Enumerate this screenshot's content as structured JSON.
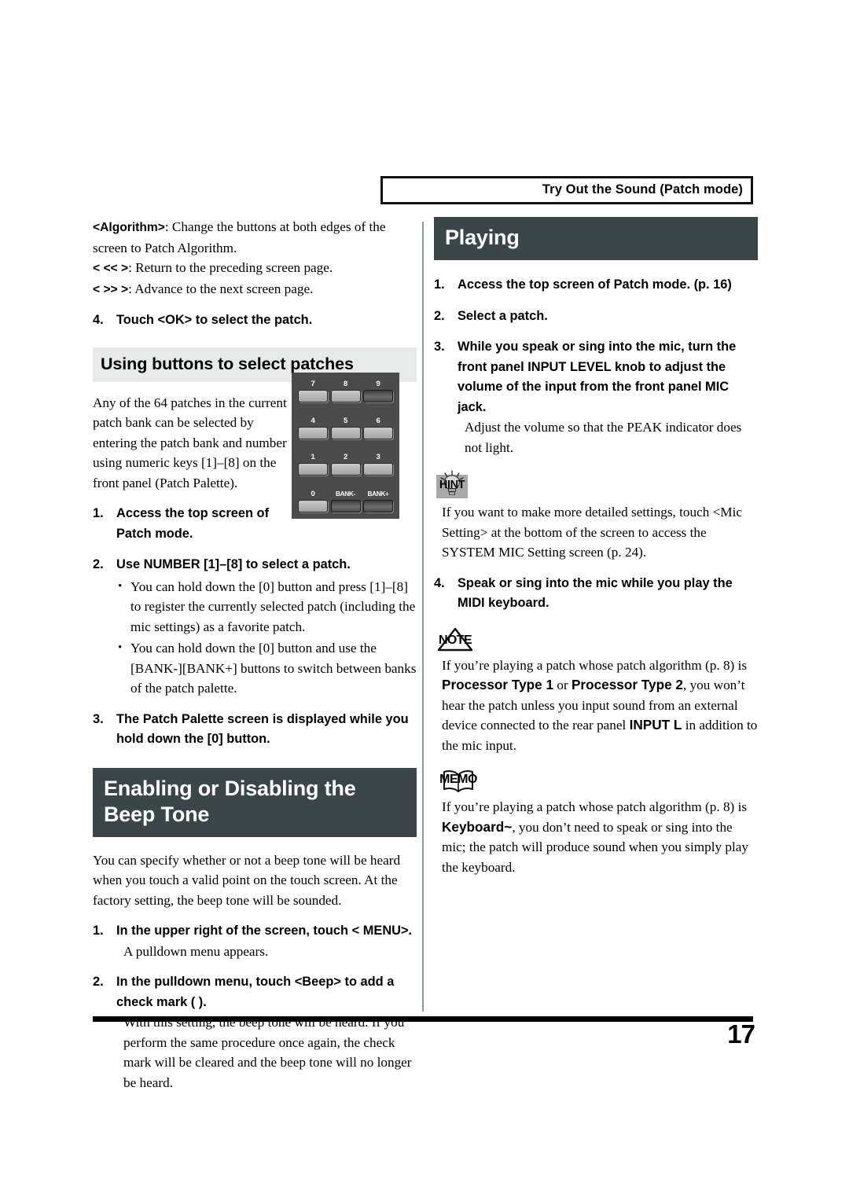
{
  "running_head": {
    "label": "Try Out the Sound (Patch mode)"
  },
  "footer": {
    "page_number": "17"
  },
  "left_column": {
    "definitions": [
      {
        "term": "<Algorithm>",
        "text": ": Change the buttons at both edges of the screen to Patch Algorithm."
      },
      {
        "term": "< << >",
        "text": ": Return to the preceding screen page."
      },
      {
        "term": "< >> >",
        "text": ": Advance to the next screen page."
      }
    ],
    "step_4": {
      "num": "4.",
      "text": "Touch <OK> to select the patch."
    },
    "subsection_heading": "Using buttons to select patches",
    "intro_paragraph": "Any of the 64 patches in the current patch bank can be selected by entering the patch bank and number using numeric keys [1]–[8] on the front panel (Patch Palette).",
    "step_1": {
      "num": "1.",
      "text": "Access the top screen of Patch mode."
    },
    "step_2": {
      "num": "2.",
      "text": "Use NUMBER [1]–[8] to select a patch."
    },
    "bullets": [
      "You can hold down the [0] button and press [1]–[8] to register the currently selected patch (including the mic settings) as a favorite patch.",
      "You can hold down the [0] button and use the [BANK-][BANK+] buttons to switch between banks of the patch palette."
    ],
    "step_3": {
      "num": "3.",
      "text": "The Patch Palette screen is displayed while you hold down the [0] button."
    },
    "section_heading": "Enabling or Disabling the Beep Tone",
    "beep_paragraph": "You can specify whether or not a beep tone will be heard when you touch a valid point on the touch screen. At the factory setting, the beep tone will be sounded.",
    "beep_step_1": {
      "num": "1.",
      "text": "In the upper right of the screen, touch <  MENU>."
    },
    "beep_step_1_note": "A pulldown menu appears.",
    "beep_step_2": {
      "num": "2.",
      "text": "In the pulldown menu, touch <Beep> to add a check mark (  )."
    },
    "beep_step_2_note": "With this setting, the beep tone will be heard. If you perform the same procedure once again, the check mark will be cleared and the beep tone will no longer be heard."
  },
  "keypad": {
    "name": "numeric-keypad",
    "rows": [
      [
        {
          "label": "7",
          "style": "light"
        },
        {
          "label": "8",
          "style": "light"
        },
        {
          "label": "9",
          "style": "dark"
        }
      ],
      [
        {
          "label": "4",
          "style": "light"
        },
        {
          "label": "5",
          "style": "light"
        },
        {
          "label": "6",
          "style": "light"
        }
      ],
      [
        {
          "label": "1",
          "style": "light"
        },
        {
          "label": "2",
          "style": "light"
        },
        {
          "label": "3",
          "style": "light"
        }
      ],
      [
        {
          "label": "0",
          "style": "light"
        },
        {
          "label": "BANK-",
          "style": "dark"
        },
        {
          "label": "BANK+",
          "style": "dark"
        }
      ]
    ]
  },
  "right_column": {
    "section_heading": "Playing",
    "step_1": {
      "num": "1.",
      "text": "Access the top screen of Patch mode. (p. 16)"
    },
    "step_2": {
      "num": "2.",
      "text": "Select a patch."
    },
    "step_3": {
      "num": "3.",
      "text": "While you speak or sing into the mic, turn the front panel INPUT LEVEL knob to adjust the volume of the input from the front panel MIC jack."
    },
    "step_3_note": "Adjust the volume so that the PEAK indicator does not light.",
    "hint": {
      "icon_label": "HINT",
      "text": "If you want to make more detailed settings, touch <Mic Setting> at the bottom of the screen to access the SYSTEM MIC Setting screen (p. 24)."
    },
    "step_4": {
      "num": "4.",
      "text": "Speak or sing into the mic while you play the MIDI keyboard."
    },
    "note": {
      "icon_label": "NOTE",
      "text_1": "If you’re playing a patch whose patch algorithm (p. 8) is ",
      "bold_1": "Processor Type 1",
      "text_2": " or ",
      "bold_2": "Processor Type 2",
      "text_3": ", you won’t hear the patch unless you input sound from an external device connected to the rear panel ",
      "bold_3": "INPUT L",
      "text_4": " in addition to the mic input."
    },
    "memo": {
      "icon_label": "MEMO",
      "text_1": "If you’re playing a patch whose patch algorithm (p. 8) is ",
      "bold_1": "Keyboard~",
      "text_2": ", you don’t need to speak or sing into the mic; the patch will produce sound when you simply play the keyboard."
    }
  }
}
